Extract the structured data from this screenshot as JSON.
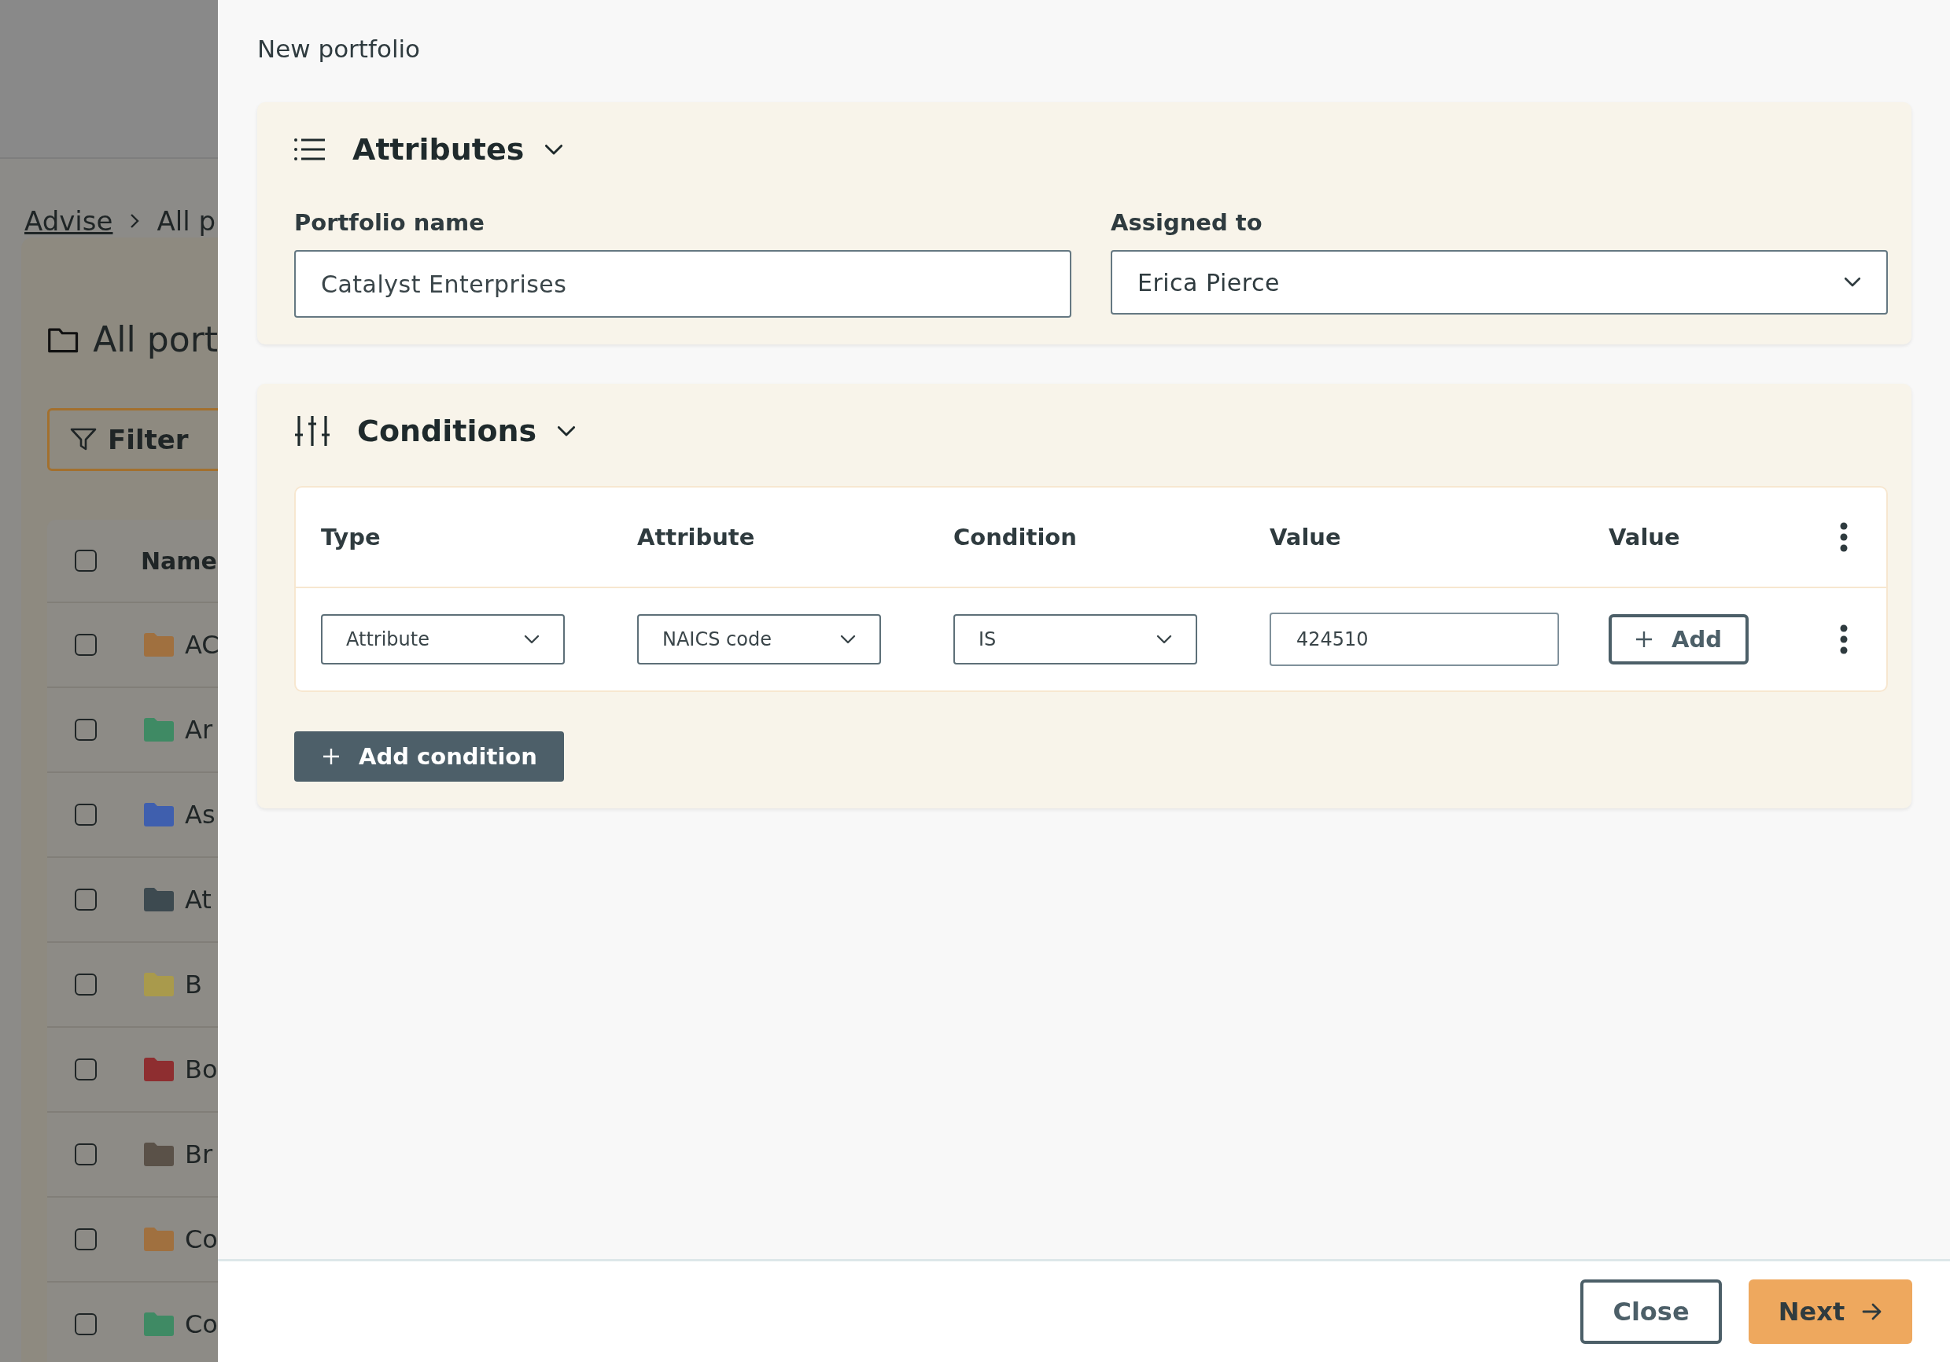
{
  "background_page": {
    "breadcrumb": [
      {
        "label": "Advise",
        "link": true
      },
      {
        "label": "All p",
        "link": false
      }
    ],
    "heading": "All port",
    "filter_button": "Filter",
    "table": {
      "header": {
        "label": "Name",
        "checked": false
      },
      "rows": [
        {
          "name": "AC",
          "color": "#a0703f",
          "checked": false
        },
        {
          "name": "Ar",
          "color": "#3f8a64",
          "checked": false
        },
        {
          "name": "As",
          "color": "#3f5fae",
          "checked": false
        },
        {
          "name": "At",
          "color": "#3d4a50",
          "checked": false
        },
        {
          "name": "B",
          "color": "#a99a4c",
          "checked": false
        },
        {
          "name": "Bo",
          "color": "#8e2e30",
          "checked": false
        },
        {
          "name": "Br",
          "color": "#5a5148",
          "checked": false
        },
        {
          "name": "Co",
          "color": "#a0703f",
          "checked": false
        },
        {
          "name": "Co",
          "color": "#3f8a64",
          "checked": false
        }
      ]
    }
  },
  "dialog": {
    "title": "New portfolio",
    "attributes": {
      "title": "Attributes",
      "expanded": true,
      "fields": [
        {
          "label": "Portfolio name",
          "kind": "text",
          "value": "Catalyst Enterprises"
        },
        {
          "label": "Assigned to",
          "kind": "select",
          "value": "Erica Pierce"
        }
      ]
    },
    "conditions": {
      "title": "Conditions",
      "expanded": true,
      "columns": [
        "Type",
        "Attribute",
        "Condition",
        "Value",
        "Value"
      ],
      "rows": [
        {
          "cells": [
            {
              "kind": "select",
              "value": "Attribute"
            },
            {
              "kind": "select",
              "value": "NAICS code"
            },
            {
              "kind": "select",
              "value": "IS"
            },
            {
              "kind": "text",
              "value": "424510"
            },
            {
              "kind": "button",
              "label": "Add"
            }
          ]
        }
      ],
      "add_button": "Add condition"
    },
    "footer": {
      "buttons": [
        {
          "label": "Close",
          "kind": "secondary"
        },
        {
          "label": "Next",
          "kind": "primary"
        }
      ]
    }
  }
}
